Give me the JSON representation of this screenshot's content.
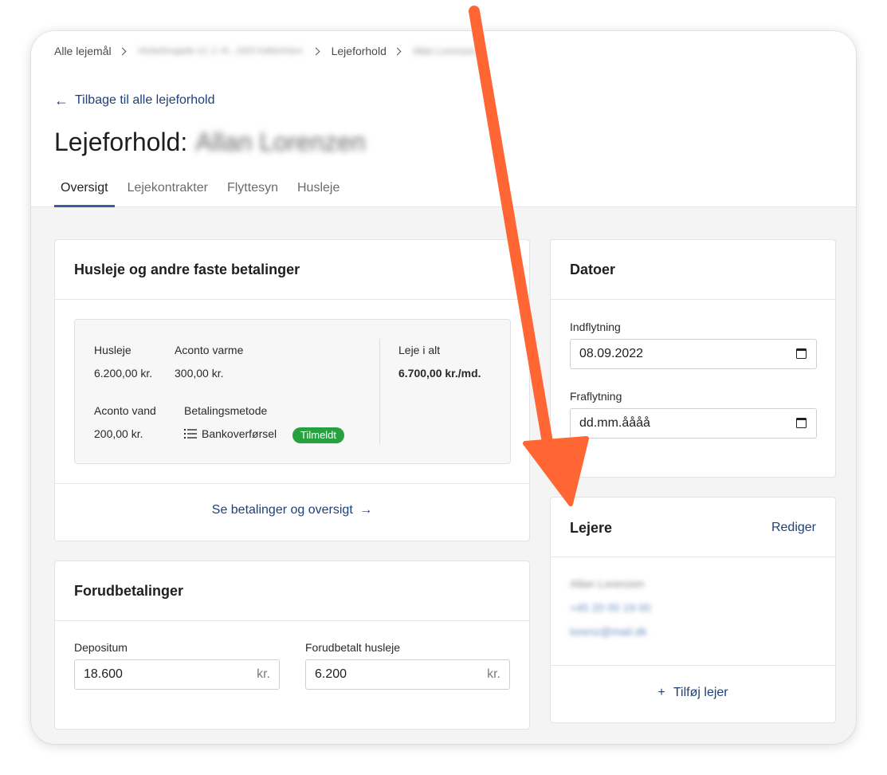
{
  "breadcrumb": {
    "items": [
      "Alle lejemål",
      "Vesterbrogade 12, 2. th., 1620 København V",
      "Lejeforhold",
      "Allan Lorenzen"
    ]
  },
  "back_link": {
    "label": "Tilbage til alle lejeforhold",
    "icon": "arrow-left-icon"
  },
  "page": {
    "title_prefix": "Lejeforhold:",
    "title_name": "Allan Lorenzen"
  },
  "tabs": [
    {
      "label": "Oversigt",
      "active": true
    },
    {
      "label": "Lejekontrakter",
      "active": false
    },
    {
      "label": "Flyttesyn",
      "active": false
    },
    {
      "label": "Husleje",
      "active": false
    }
  ],
  "rent_card": {
    "title": "Husleje og andre faste betalinger",
    "items": {
      "husleje": {
        "label": "Husleje",
        "value": "6.200,00 kr."
      },
      "aconto_varme": {
        "label": "Aconto varme",
        "value": "300,00 kr."
      },
      "aconto_vand": {
        "label": "Aconto vand",
        "value": "200,00 kr."
      },
      "betalingsmetode": {
        "label": "Betalingsmetode",
        "value": "Bankoverførsel",
        "badge": "Tilmeldt",
        "icon": "list-icon"
      },
      "total": {
        "label": "Leje i alt",
        "value": "6.700,00 kr./md."
      }
    },
    "link": "Se betalinger og oversigt"
  },
  "prepay_card": {
    "title": "Forudbetalinger",
    "depositum": {
      "label": "Depositum",
      "value": "18.600",
      "suffix": "kr."
    },
    "forudbetalt": {
      "label": "Forudbetalt husleje",
      "value": "6.200",
      "suffix": "kr."
    }
  },
  "dates_card": {
    "title": "Datoer",
    "indflytning": {
      "label": "Indflytning",
      "value": "08.09.2022"
    },
    "fraflytning": {
      "label": "Fraflytning",
      "value": "dd.mm.åååå"
    }
  },
  "tenants_card": {
    "title": "Lejere",
    "edit": "Rediger",
    "tenant": {
      "name": "Allan Lorenzen",
      "phone": "+45 20 00 19 00",
      "email": "lorenz@mail.dk"
    },
    "add": "Tilføj lejer"
  },
  "colors": {
    "accent": "#1d3f7a",
    "badge": "#27a040",
    "annotation_arrow": "#ff6633"
  }
}
